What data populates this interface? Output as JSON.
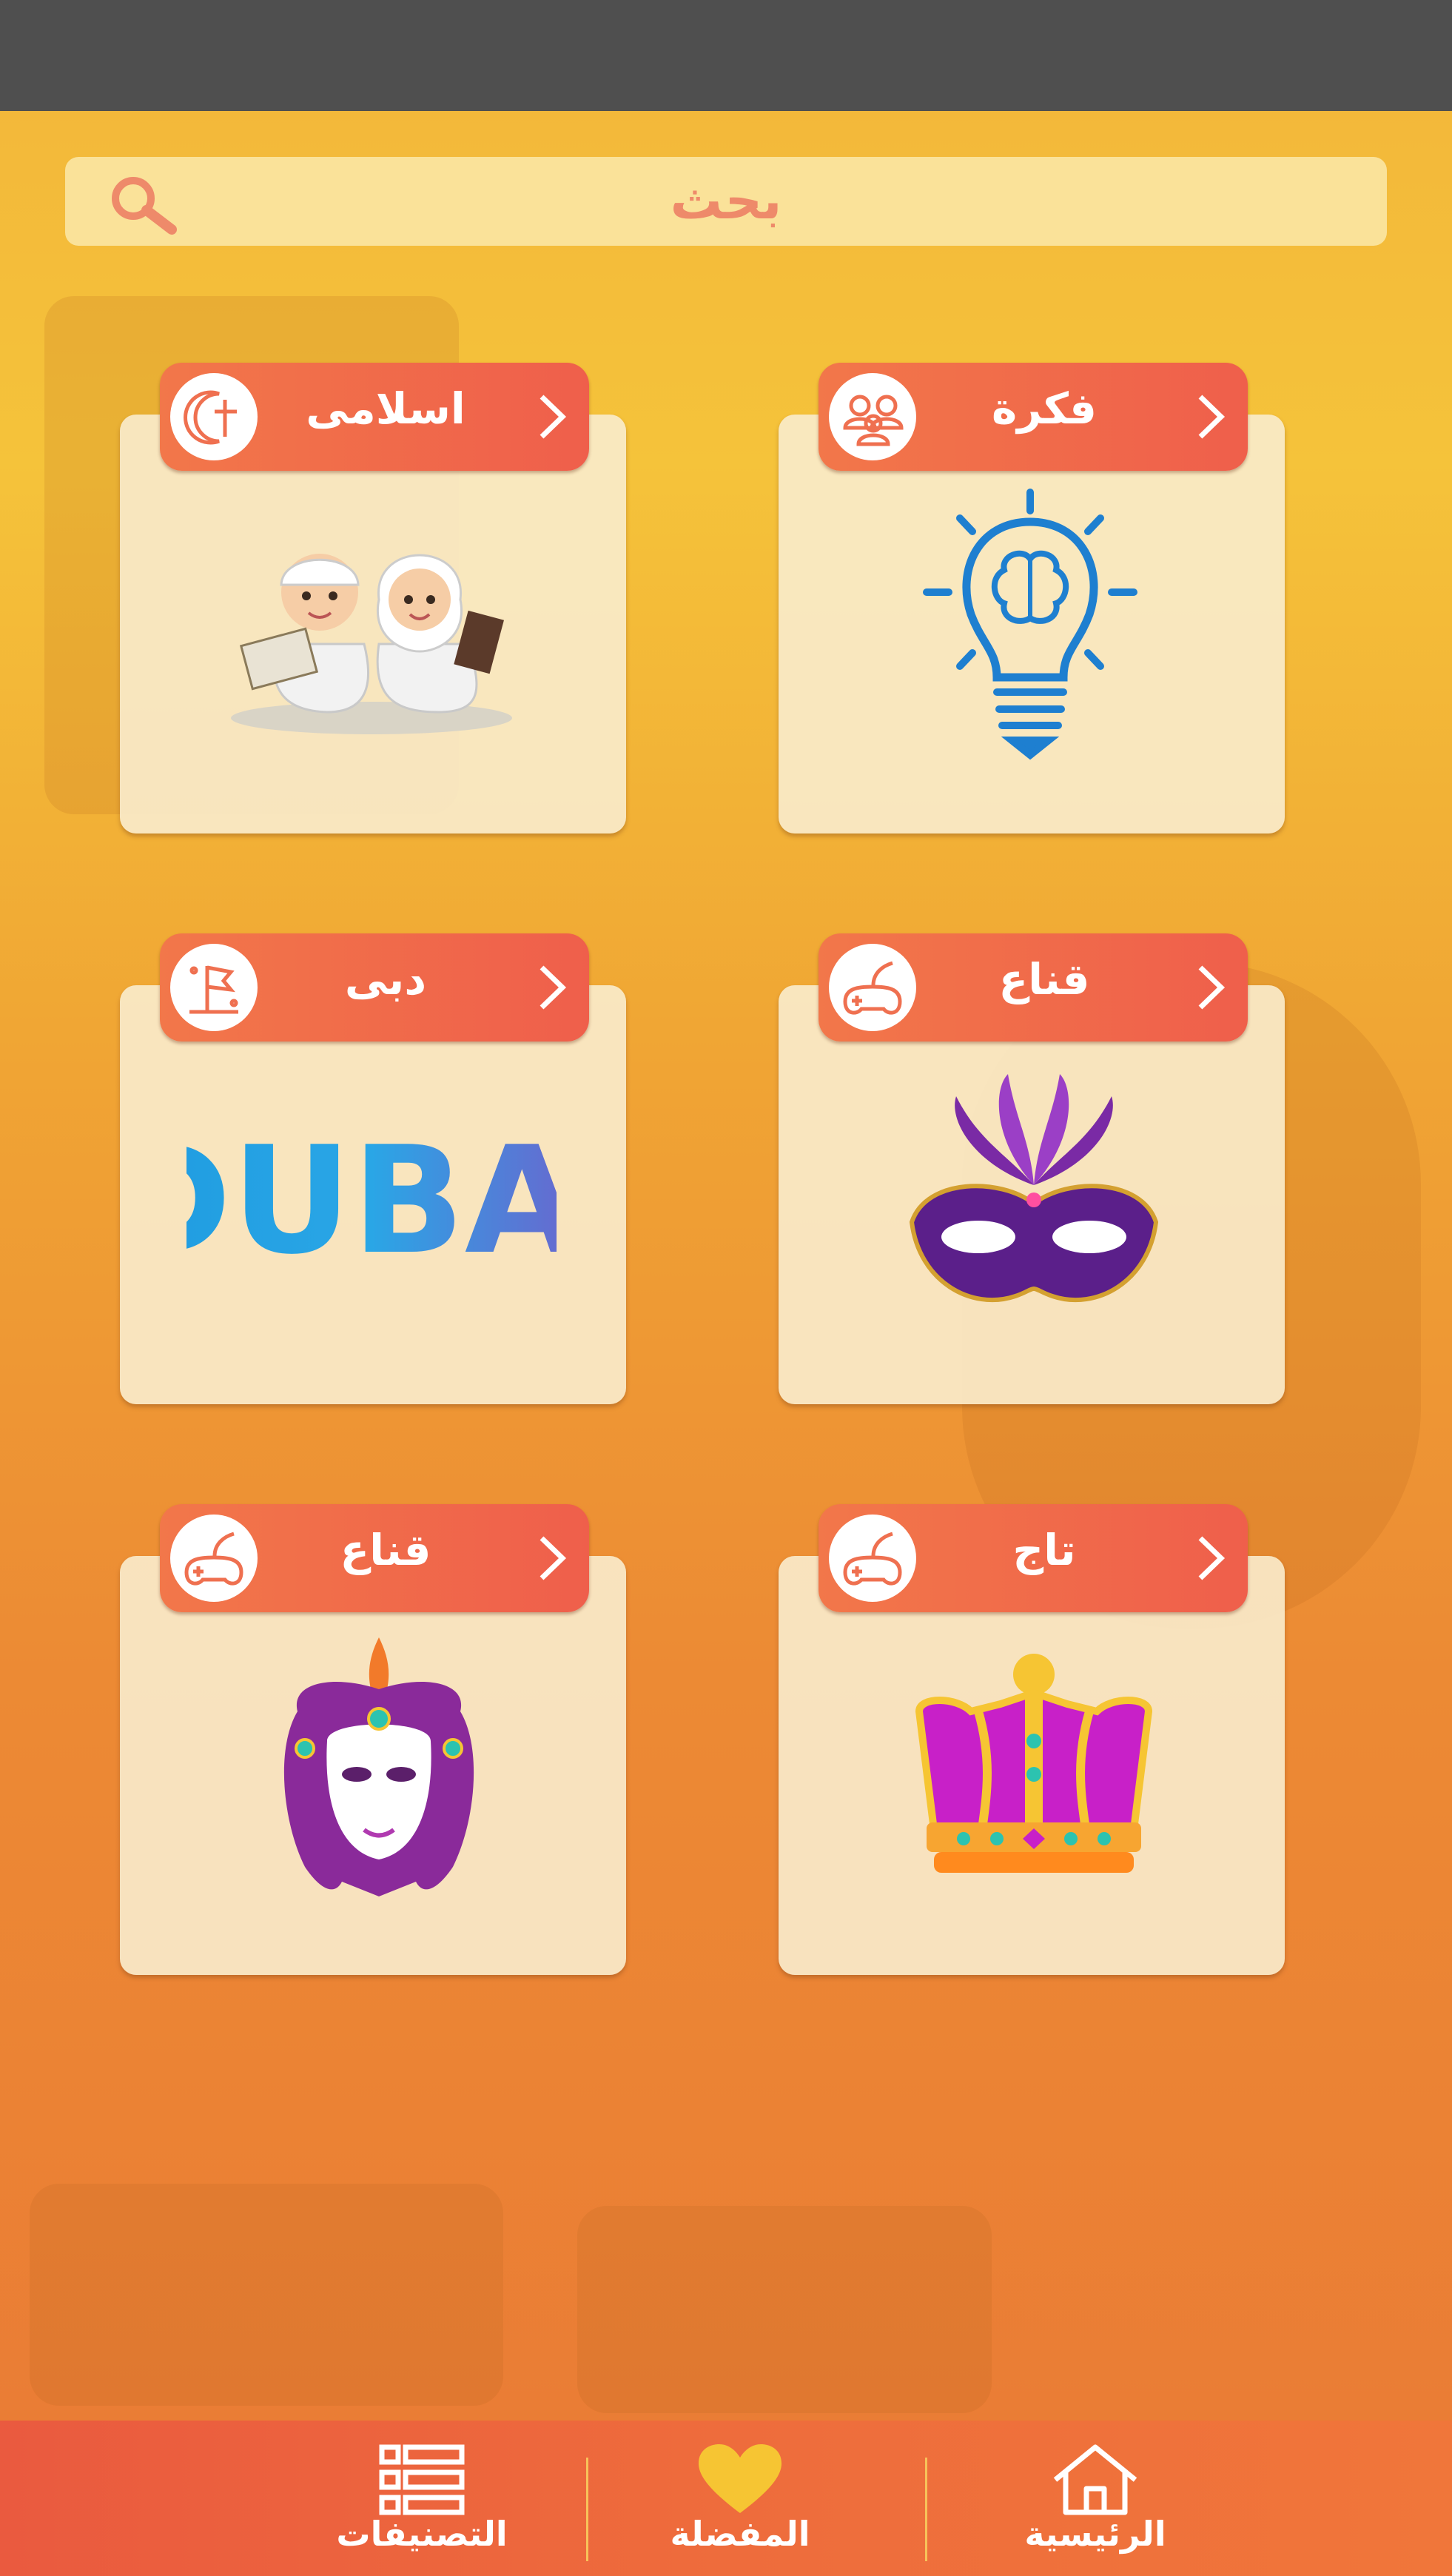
{
  "search": {
    "placeholder": "بحث",
    "icon": "search-icon"
  },
  "cards": [
    {
      "title": "فكرة",
      "badge_icon": "people-icon",
      "art": "lightbulb-brain-image"
    },
    {
      "title": "اسلامى",
      "badge_icon": "crescent-cross-icon",
      "art": "kids-reading-image"
    },
    {
      "title": "قناع",
      "badge_icon": "gamepad-icon",
      "art": "purple-mask-image"
    },
    {
      "title": "دبى",
      "badge_icon": "flag-icon",
      "art": "dubai-logo-image"
    },
    {
      "title": "تاج",
      "badge_icon": "gamepad-icon",
      "art": "crown-image"
    },
    {
      "title": "قناع",
      "badge_icon": "gamepad-icon",
      "art": "venetian-mask-image"
    }
  ],
  "dubai_logo_text": "DUBAI",
  "nav": {
    "home": "الرئيسية",
    "favorites": "المفضلة",
    "categories": "التصنيفات"
  },
  "colors": {
    "accent": "#ef5f4b",
    "statusbar": "#4f4f4f",
    "card_bg": "#faeccd"
  }
}
